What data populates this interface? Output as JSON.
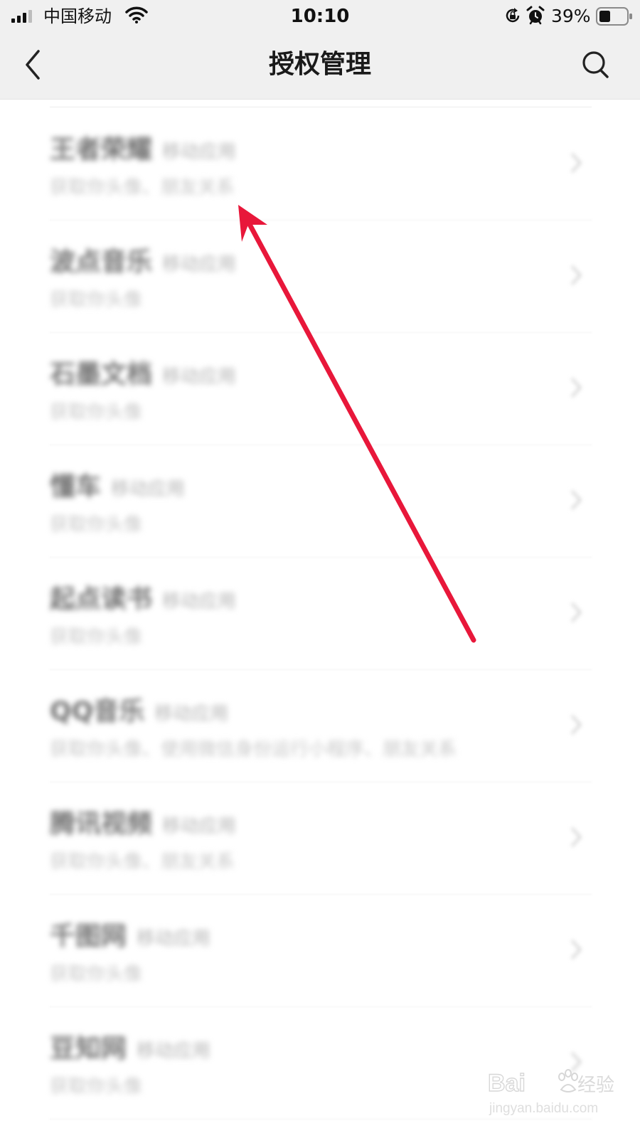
{
  "status_bar": {
    "carrier": "中国移动",
    "time": "10:10",
    "battery": "39%",
    "icons": [
      "signal-icon",
      "wifi-icon",
      "rotation-lock-icon",
      "alarm-icon",
      "battery-icon"
    ]
  },
  "nav": {
    "title": "授权管理",
    "back_icon": "chevron-left-icon",
    "search_icon": "search-icon"
  },
  "list": {
    "items": [
      {
        "name": "王者荣耀",
        "tag": "移动应用",
        "desc": "获取你头像、朋友关系"
      },
      {
        "name": "波点音乐",
        "tag": "移动应用",
        "desc": "获取你头像"
      },
      {
        "name": "石墨文档",
        "tag": "移动应用",
        "desc": "获取你头像"
      },
      {
        "name": "懂车",
        "tag": "移动应用",
        "desc": "获取你头像"
      },
      {
        "name": "起点读书",
        "tag": "移动应用",
        "desc": "获取你头像"
      },
      {
        "name": "QQ音乐",
        "tag": "移动应用",
        "desc": "获取你头像、使用微信身份运行小程序、朋友关系"
      },
      {
        "name": "腾讯视频",
        "tag": "移动应用",
        "desc": "获取你头像、朋友关系"
      },
      {
        "name": "千图网",
        "tag": "移动应用",
        "desc": "获取你头像"
      },
      {
        "name": "豆知网",
        "tag": "移动应用",
        "desc": "获取你头像"
      }
    ]
  },
  "annotation": {
    "color": "#e8173a"
  },
  "watermark": {
    "brand": "Baidu经验",
    "url": "jingyan.baidu.com"
  }
}
